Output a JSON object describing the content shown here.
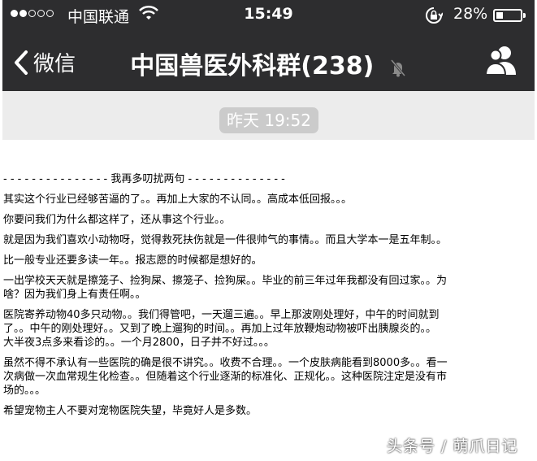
{
  "status_bar": {
    "carrier": "中国联通",
    "time": "15:49",
    "battery_percent": "28%",
    "battery_level": 0.28,
    "signal_bars_filled": 2,
    "signal_bars_total": 5
  },
  "nav": {
    "back_label": "微信",
    "title": "中国兽医外科群(238)",
    "icons": [
      "back-chevron-icon",
      "mute-bell-icon",
      "group-contacts-icon"
    ]
  },
  "chat": {
    "timestamp": "昨天 19:52"
  },
  "article": {
    "separator": "- - - - - - - - - - - - - - - 我再多叨扰两句 - - - - - - - - - - - - - -",
    "paragraphs": [
      [
        "其实这个行业已经够苦逼的了。。再加上大家的不认同。。高成本低回报。。。"
      ],
      [
        "你要问我们为什么都这样了，还从事这个行业。。"
      ],
      [
        "就是因为我们喜欢小动物呀，觉得救死扶伤就是一件很帅气的事情。。而且大学本一是五年制。。"
      ],
      [
        "比一般专业还要多读一年。。报志愿的时候都是想好的。"
      ],
      [
        "一出学校天天就是擦笼子、捡狗屎、擦笼子、捡狗屎。。毕业的前三年过年我都没有回过家。。为",
        "啥？因为我们身上有责任啊。。"
      ],
      [
        "医院寄养动物40多只动物。。我们得管吧，一天遛三遍。。早上那波刚处理好，中午的时间就到",
        "了。。中午的刚处理好。。又到了晚上遛狗的时间。。再加上过年放鞭炮动物被吓出胰腺炎的。。",
        "大半夜3点多来看诊的。。一个月2800，日子并不好过。。。"
      ],
      [
        "虽然不得不承认有一些医院的确是很不讲究。。收费不合理。。一个皮肤病能看到8000多。。看一",
        "次病做一次血常规生化检查。。但随着这个行业逐渐的标准化、正规化。。这种医院注定是没有市",
        "场的。。。"
      ],
      [
        "希望宠物主人不要对宠物医院失望，毕竟好人是多数。"
      ]
    ]
  },
  "watermark": "头条号 / 萌爪日记"
}
